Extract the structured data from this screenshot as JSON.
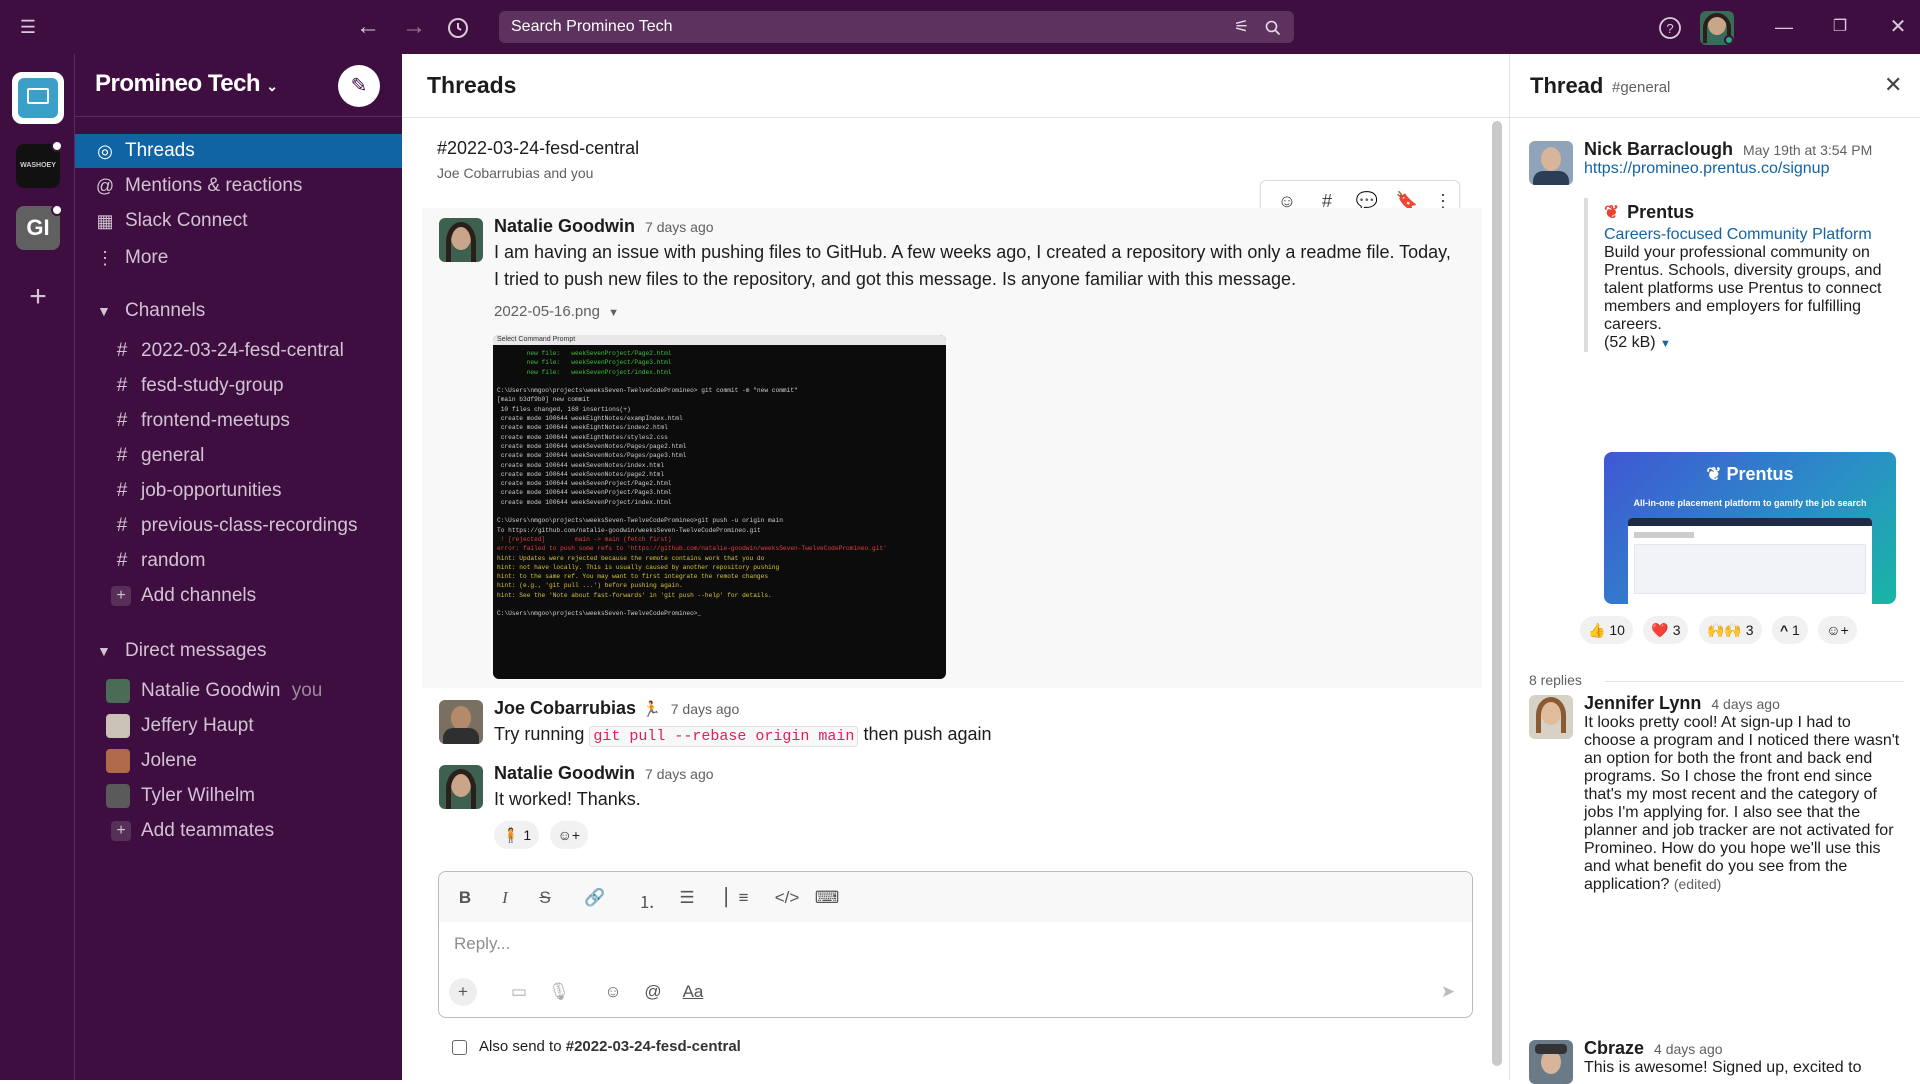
{
  "topbar": {
    "search_text": "Search Promineo Tech",
    "menu_icon": "hamburger-icon",
    "back_icon": "arrow-left-icon",
    "forward_icon": "arrow-right-icon",
    "history_icon": "clock-icon",
    "filter_icon": "sliders-icon",
    "search_icon": "search-icon",
    "help_icon": "help-icon"
  },
  "rail": {
    "workspace_initials_2": "WASHOEY",
    "workspace_initials_3": "GI"
  },
  "sidebar": {
    "workspace_name": "Promineo Tech",
    "nav": [
      {
        "label": "Threads",
        "icon": "threads-icon"
      },
      {
        "label": "Mentions & reactions",
        "icon": "at-icon"
      },
      {
        "label": "Slack Connect",
        "icon": "building-icon"
      },
      {
        "label": "More",
        "icon": "more-vertical-icon"
      }
    ],
    "channels_label": "Channels",
    "channels": [
      "2022-03-24-fesd-central",
      "fesd-study-group",
      "frontend-meetups",
      "general",
      "job-opportunities",
      "previous-class-recordings",
      "random"
    ],
    "add_channels": "Add channels",
    "dm_label": "Direct messages",
    "dms": [
      {
        "name": "Natalie Goodwin",
        "suffix": "you"
      },
      {
        "name": "Jeffery Haupt",
        "suffix": ""
      },
      {
        "name": "Jolene",
        "suffix": ""
      },
      {
        "name": "Tyler Wilhelm",
        "suffix": ""
      }
    ],
    "add_teammates": "Add teammates"
  },
  "main": {
    "title": "Threads",
    "thread_channel": "#2022-03-24-fesd-central",
    "thread_participants": "Joe Cobarrubias and you",
    "messages": [
      {
        "name": "Natalie Goodwin",
        "time": "7 days ago",
        "text": "I am having an issue with pushing files to GitHub. A few weeks ago, I created a repository with only a readme file. Today, I tried to push new files to the repository, and got this message. Is anyone familiar with this message.",
        "attachment": "2022-05-16.png"
      },
      {
        "name": "Joe Cobarrubias",
        "emoji": "🏃",
        "time": "7 days ago",
        "text_before": "Try running",
        "code": "git pull --rebase origin main",
        "text_after": "then push again"
      },
      {
        "name": "Natalie Goodwin",
        "time": "7 days ago",
        "text": "It worked! Thanks.",
        "reaction_count": "1"
      }
    ],
    "terminal_title": "Select Command Prompt",
    "terminal_lines": [
      "        new file:   weekSevenProject/Page2.html",
      "        new file:   weekSevenProject/Page3.html",
      "        new file:   weekSevenProject/index.html",
      "",
      "C:\\Users\\nmgoo\\projects\\weeksSeven-TwelveCodePromineo> git commit -m \"new commit\"",
      "[main b3df9b0] new commit",
      " 10 files changed, 168 insertions(+)",
      " create mode 100644 weekEightNotes/exampIndex.html",
      " create mode 100644 weekEightNotes/index2.html",
      " create mode 100644 weekEightNotes/styles2.css",
      " create mode 100644 weekSevenNotes/Pages/page2.html",
      " create mode 100644 weekSevenNotes/Pages/page3.html",
      " create mode 100644 weekSevenNotes/index.html",
      " create mode 100644 weekSevenNotes/page2.html",
      " create mode 100644 weekSevenProject/Page2.html",
      " create mode 100644 weekSevenProject/Page3.html",
      " create mode 100644 weekSevenProject/index.html",
      "",
      "C:\\Users\\nmgoo\\projects\\weeksSeven-TwelveCodePromineo>git push -u origin main",
      "To https://github.com/natalie-goodwin/weeksSeven-TwelveCodePromineo.git",
      " ! [rejected]        main -> main (fetch first)",
      "error: failed to push some refs to 'https://github.com/natalie-goodwin/weeksSeven-TwelveCodePromineo.git'",
      "hint: Updates were rejected because the remote contains work that you do",
      "hint: not have locally. This is usually caused by another repository pushing",
      "hint: to the same ref. You may want to first integrate the remote changes",
      "hint: (e.g., 'git pull ...') before pushing again.",
      "hint: See the 'Note about fast-forwards' in 'git push --help' for details.",
      "",
      "C:\\Users\\nmgoo\\projects\\weeksSeven-TwelveCodePromineo>_"
    ],
    "composer_placeholder": "Reply...",
    "also_send_label": "Also send to",
    "also_send_channel": "#2022-03-24-fesd-central"
  },
  "thread": {
    "title": "Thread",
    "channel": "#general",
    "parent": {
      "name": "Nick Barraclough",
      "time": "May 19th at 3:54 PM",
      "link": "https://promineo.prentus.co/signup",
      "unfurl_site": "Prentus",
      "unfurl_title": "Careers-focused Community Platform",
      "unfurl_desc": "Build your professional community on Prentus. Schools, diversity groups, and talent platforms use Prentus to connect members and employers for fulfilling careers.",
      "unfurl_size": "(52 kB)",
      "image_brand": "Prentus",
      "image_tagline": "All-in-one placement platform to gamify the job search",
      "reactions": [
        {
          "emoji": "👍",
          "count": "10"
        },
        {
          "emoji": "❤️",
          "count": "3"
        },
        {
          "emoji": "🙌🙌",
          "count": "3"
        },
        {
          "emoji": "^",
          "count": "1"
        }
      ]
    },
    "replies_count": "8 replies",
    "replies": [
      {
        "name": "Jennifer Lynn",
        "time": "4 days ago",
        "text": "It looks pretty cool! At sign-up I had to choose a program and I noticed there wasn't an option for both the front and back end programs. So I chose the front end since that's my most recent and the category of jobs I'm applying for. I also see that the planner and job tracker are not activated for Promineo. How do you hope we'll use this and what benefit do you see from the application?",
        "edited": "(edited)"
      },
      {
        "name": "Cbraze",
        "time": "4 days ago",
        "text": "This is awesome! Signed up, excited to"
      }
    ]
  },
  "colors": {
    "aubergine": "#3f0e40",
    "active": "#1164a3",
    "link": "#1264a3"
  }
}
